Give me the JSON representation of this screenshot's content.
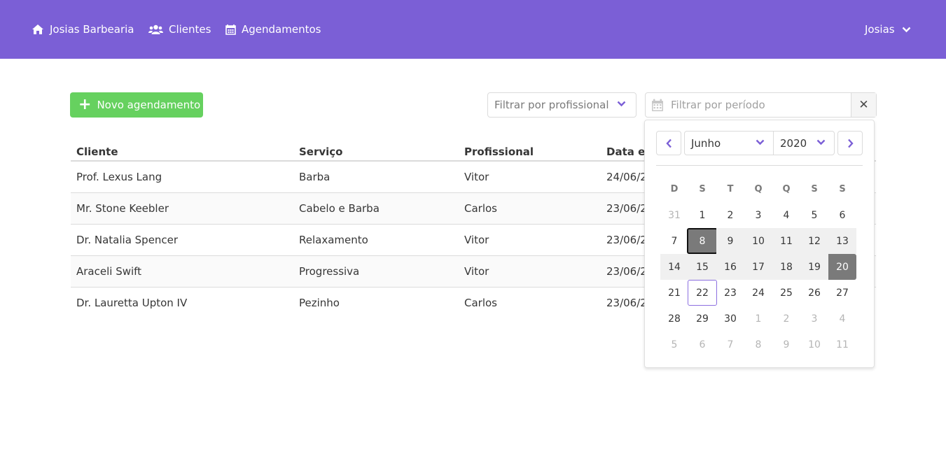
{
  "navbar": {
    "brand": "Josias Barbearia",
    "clients": "Clientes",
    "appointments": "Agendamentos",
    "user": "Josias",
    "bg_color": "#7b5fd6"
  },
  "toolbar": {
    "new_button": "Novo agendamento",
    "new_button_color": "#66d15f",
    "professional_placeholder": "Filtrar por profissional",
    "period_placeholder": "Filtrar por período"
  },
  "table": {
    "headers": [
      "Cliente",
      "Serviço",
      "Profissional",
      "Data e hora"
    ],
    "rows": [
      [
        "Prof. Lexus Lang",
        "Barba",
        "Vitor",
        "24/06/2"
      ],
      [
        "Mr. Stone Keebler",
        "Cabelo e Barba",
        "Carlos",
        "23/06/2"
      ],
      [
        "Dr. Natalia Spencer",
        "Relaxamento",
        "Vitor",
        "23/06/2"
      ],
      [
        "Araceli Swift",
        "Progressiva",
        "Vitor",
        "23/06/2"
      ],
      [
        "Dr. Lauretta Upton IV",
        "Pezinho",
        "Carlos",
        "23/06/2"
      ]
    ]
  },
  "calendar": {
    "month": "Junho",
    "year": "2020",
    "weekdays": [
      "D",
      "S",
      "T",
      "Q",
      "Q",
      "S",
      "S"
    ],
    "weeks": [
      [
        "31",
        "1",
        "2",
        "3",
        "4",
        "5",
        "6"
      ],
      [
        "7",
        "8",
        "9",
        "10",
        "11",
        "12",
        "13"
      ],
      [
        "14",
        "15",
        "16",
        "17",
        "18",
        "19",
        "20"
      ],
      [
        "21",
        "22",
        "23",
        "24",
        "25",
        "26",
        "27"
      ],
      [
        "28",
        "29",
        "30",
        "1",
        "2",
        "3",
        "4"
      ],
      [
        "5",
        "6",
        "7",
        "8",
        "9",
        "10",
        "11"
      ]
    ],
    "range_start": "8",
    "range_end": "20",
    "today": "22",
    "accent_color": "#7b5fd6"
  }
}
